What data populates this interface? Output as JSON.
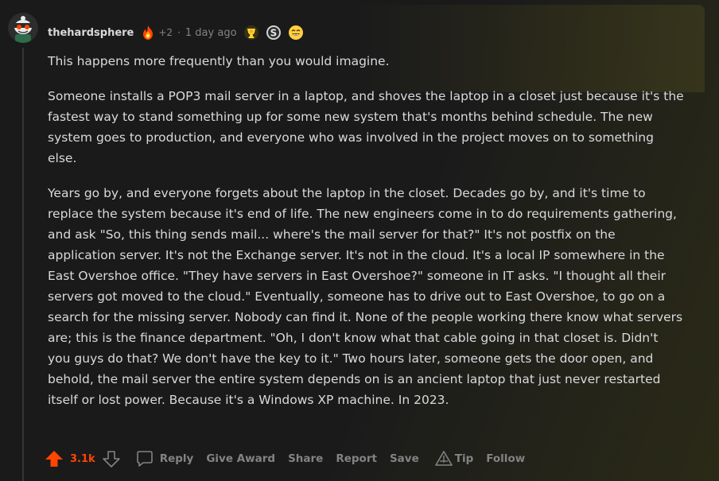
{
  "comment": {
    "author": "thehardsphere",
    "extra_awards": "+2",
    "separator": "·",
    "timestamp": "1 day ago",
    "paragraphs": [
      "This happens more frequently than you would imagine.",
      "Someone installs a POP3 mail server in a laptop, and shoves the laptop in a closet just because it's the fastest way to stand something up for some new system that's months behind schedule. The new system goes to production, and everyone who was involved in the project moves on to something else.",
      "Years go by, and everyone forgets about the laptop in the closet. Decades go by, and it's time to replace the system because it's end of life. The new engineers come in to do requirements gathering, and ask \"So, this thing sends mail... where's the mail server for that?\" It's not postfix on the application server. It's not the Exchange server. It's not in the cloud. It's a local IP somewhere in the East Overshoe office. \"They have servers in East Overshoe?\" someone in IT asks. \"I thought all their servers got moved to the cloud.\" Eventually, someone has to drive out to East Overshoe, to go on a search for the missing server. Nobody can find it. None of the people working there know what servers are; this is the finance department. \"Oh, I don't know what that cable going in that closet is. Didn't you guys do that? We don't have the key to it.\" Two hours later, someone gets the door open, and behold, the mail server the entire system depends on is an ancient laptop that just never restarted itself or lost power. Because it's a Windows XP machine. In 2023."
    ],
    "vote_count": "3.1k",
    "actions": {
      "reply": "Reply",
      "give_award": "Give Award",
      "share": "Share",
      "report": "Report",
      "save": "Save",
      "tip": "Tip",
      "follow": "Follow"
    },
    "icons": {
      "avatar": "snoo-avatar-icon",
      "flair": "fire-flair-icon",
      "award_1": "gold-trophy-award-icon",
      "award_2": "silver-s-award-icon",
      "award_3": "laughing-face-award-icon"
    },
    "colors": {
      "upvote": "#ff4500",
      "background": "#1a1a1b",
      "text": "#d7dadc",
      "muted": "#818384"
    }
  }
}
